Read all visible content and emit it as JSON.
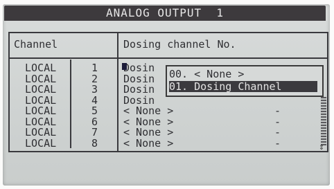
{
  "title": "ANALOG OUTPUT  1",
  "headers": {
    "channel": "Channel",
    "dosing": "Dosing channel No."
  },
  "rows": [
    {
      "location": "LOCAL",
      "num": "1",
      "dosing": "Dosin",
      "dash": ""
    },
    {
      "location": "LOCAL",
      "num": "2",
      "dosing": "Dosin",
      "dash": ""
    },
    {
      "location": "LOCAL",
      "num": "3",
      "dosing": "Dosin",
      "dash": ""
    },
    {
      "location": "LOCAL",
      "num": "4",
      "dosing": "Dosin",
      "dash": ""
    },
    {
      "location": "LOCAL",
      "num": "5",
      "dosing": "< None >",
      "dash": "-"
    },
    {
      "location": "LOCAL",
      "num": "6",
      "dosing": "< None >",
      "dash": "-"
    },
    {
      "location": "LOCAL",
      "num": "7",
      "dosing": "< None >",
      "dash": "-"
    },
    {
      "location": "LOCAL",
      "num": "8",
      "dosing": "< None >",
      "dash": "-"
    }
  ],
  "popup": {
    "options": [
      {
        "label": "00. < None >"
      },
      {
        "label": "01. Dosing Channel"
      }
    ],
    "selected_index": 1
  },
  "scroll_arrow": "⇕"
}
